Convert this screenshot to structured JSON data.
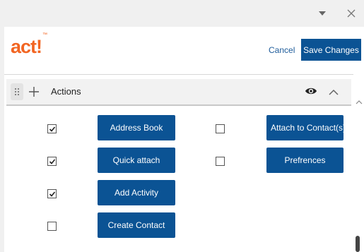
{
  "window": {
    "dropdown_icon": "chevron-down-icon",
    "close_icon": "close-icon"
  },
  "header": {
    "logo_text": "act!",
    "logo_trademark": "™",
    "cancel_label": "Cancel",
    "save_label": "Save Changes"
  },
  "section": {
    "title": "Actions",
    "visibility_icon": "eye-icon",
    "collapse_icon": "chevron-up-icon"
  },
  "actions_left": [
    {
      "label": "Address Book",
      "checked": true
    },
    {
      "label": "Quick attach",
      "checked": true
    },
    {
      "label": "Add Activity",
      "checked": true
    },
    {
      "label": "Create Contact",
      "checked": false
    }
  ],
  "actions_right": [
    {
      "label": "Attach to Contact(s)",
      "checked": false
    },
    {
      "label": "Prefrences",
      "checked": false
    }
  ],
  "colors": {
    "brand_orange": "#f26522",
    "button_blue": "#0b5394",
    "link_blue": "#1d5b9a"
  }
}
